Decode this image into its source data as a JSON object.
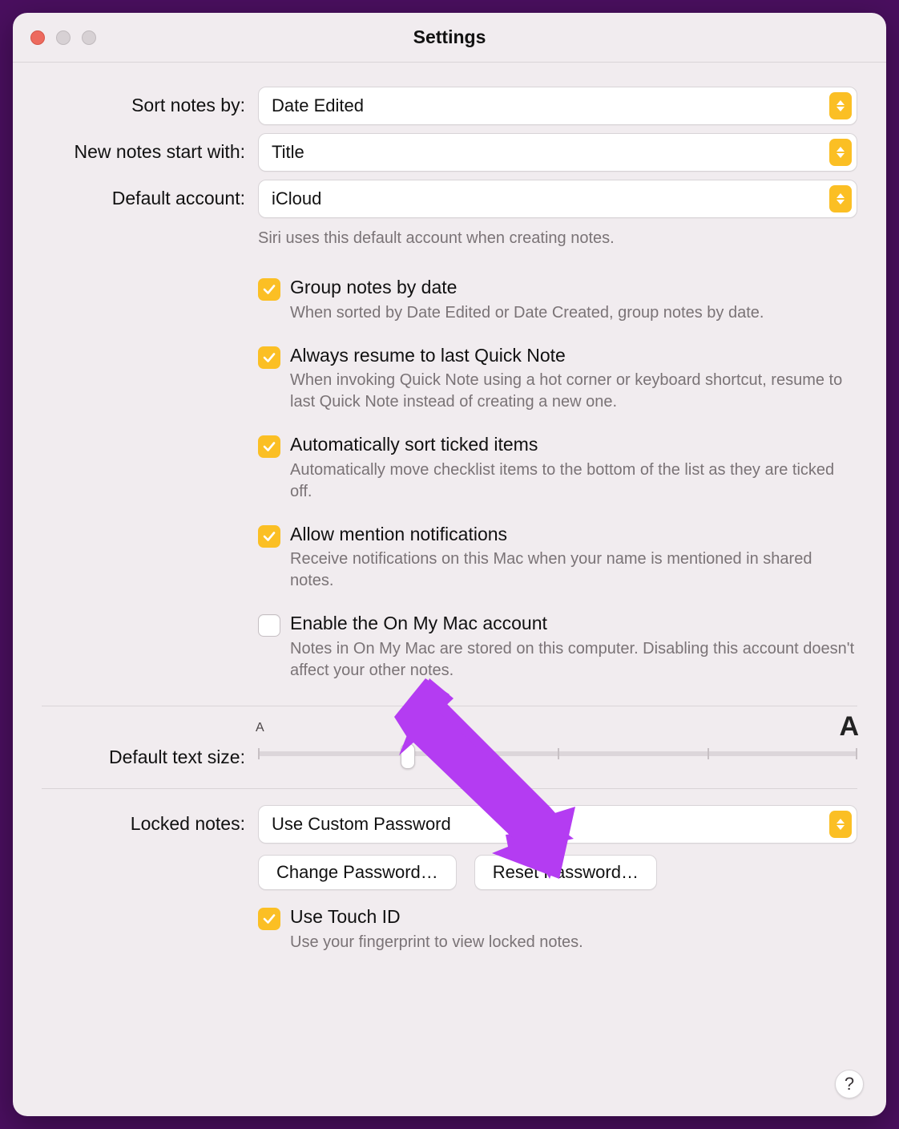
{
  "window": {
    "title": "Settings"
  },
  "dropdowns": {
    "sort_label": "Sort notes by:",
    "sort_value": "Date Edited",
    "newnotes_label": "New notes start with:",
    "newnotes_value": "Title",
    "default_account_label": "Default account:",
    "default_account_value": "iCloud",
    "default_account_help": "Siri uses this default account when creating notes.",
    "locked_label": "Locked notes:",
    "locked_value": "Use Custom Password"
  },
  "checkboxes": {
    "group_date": {
      "label": "Group notes by date",
      "desc": "When sorted by Date Edited or Date Created, group notes by date.",
      "checked": true
    },
    "resume_quick": {
      "label": "Always resume to last Quick Note",
      "desc": "When invoking Quick Note using a hot corner or keyboard shortcut, resume to last Quick Note instead of creating a new one.",
      "checked": true
    },
    "auto_sort": {
      "label": "Automatically sort ticked items",
      "desc": "Automatically move checklist items to the bottom of the list as they are ticked off.",
      "checked": true
    },
    "mentions": {
      "label": "Allow mention notifications",
      "desc": "Receive notifications on this Mac when your name is mentioned in shared notes.",
      "checked": true
    },
    "on_my_mac": {
      "label": "Enable the On My Mac account",
      "desc": "Notes in On My Mac are stored on this computer. Disabling this account doesn't affect your other notes.",
      "checked": false
    },
    "touch_id": {
      "label": "Use Touch ID",
      "desc": "Use your fingerprint to view locked notes.",
      "checked": true
    }
  },
  "slider": {
    "label": "Default text size:",
    "small_marker": "A",
    "large_marker": "A",
    "value": 0.25,
    "ticks": 5
  },
  "buttons": {
    "change_pw": "Change Password…",
    "reset_pw": "Reset Password…",
    "help": "?"
  },
  "annotation": {
    "arrow_target": "reset-password-button",
    "color": "#b43cf2"
  }
}
